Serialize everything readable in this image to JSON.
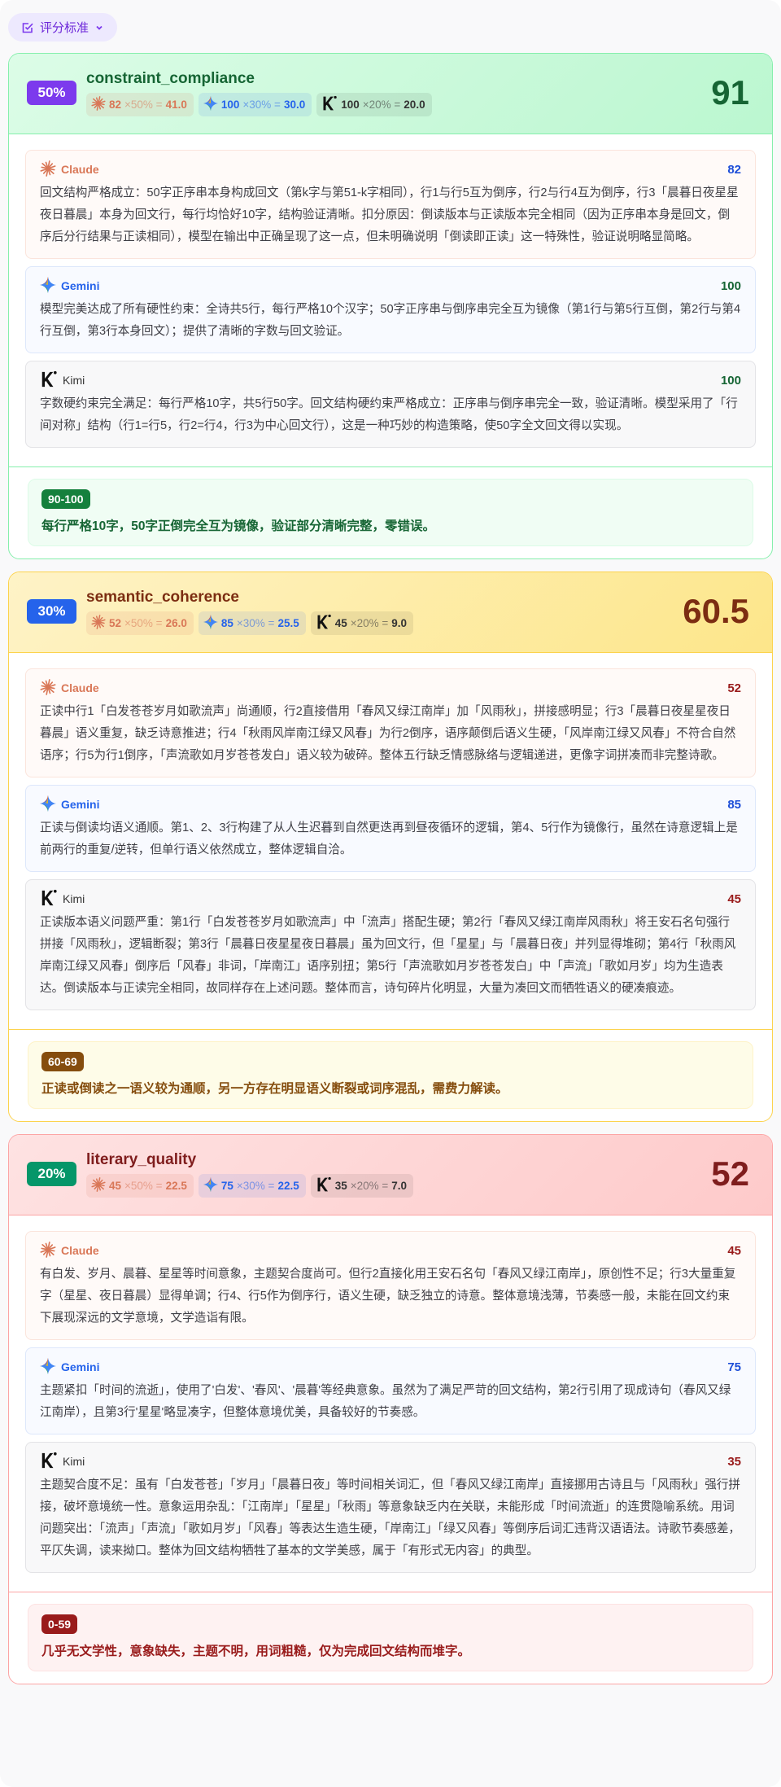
{
  "toggle": {
    "label": "评分标准",
    "icon": "checkbox-icon",
    "chevron": "chevron-down-icon"
  },
  "colors": {
    "claude": "#d97757",
    "gemini": "#2563eb",
    "kimi": "#222222",
    "score_high": "#166534",
    "score_mid": "#1d4ed8",
    "score_low": "#991b1b"
  },
  "sections": [
    {
      "weight": "50%",
      "criterion": "constraint_compliance",
      "total": "91",
      "theme": {
        "bg1": "#dcfce7",
        "bg2": "#bbf7d0",
        "border": "#86efac",
        "title": "#166534",
        "weight_bg": "#7c3aed",
        "rub_bg": "#f0fdf4",
        "rub_border": "#dcfce7",
        "rub_badge": "#15803d",
        "rub_text": "#166534"
      },
      "chips": [
        {
          "model": "claude",
          "score": "82",
          "mul": "×50% =",
          "result": "41.0"
        },
        {
          "model": "gemini",
          "score": "100",
          "mul": "×30% =",
          "result": "30.0"
        },
        {
          "model": "kimi",
          "score": "100",
          "mul": "×20% =",
          "result": "20.0"
        }
      ],
      "cards": [
        {
          "model": "claude",
          "name": "Claude",
          "score": "82",
          "level": "mid",
          "text": "回文结构严格成立：50字正序串本身构成回文（第k字与第51-k字相同），行1与行5互为倒序，行2与行4互为倒序，行3「晨暮日夜星星夜日暮晨」本身为回文行，每行均恰好10字，结构验证清晰。扣分原因：倒读版本与正读版本完全相同（因为正序串本身是回文，倒序后分行结果与正读相同），模型在输出中正确呈现了这一点，但未明确说明「倒读即正读」这一特殊性，验证说明略显简略。"
        },
        {
          "model": "gemini",
          "name": "Gemini",
          "score": "100",
          "level": "high",
          "text": "模型完美达成了所有硬性约束：全诗共5行，每行严格10个汉字；50字正序串与倒序串完全互为镜像（第1行与第5行互倒，第2行与第4行互倒，第3行本身回文）；提供了清晰的字数与回文验证。"
        },
        {
          "model": "kimi",
          "name": "Kimi",
          "score": "100",
          "level": "high",
          "text": "字数硬约束完全满足：每行严格10字，共5行50字。回文结构硬约束严格成立：正序串与倒序串完全一致，验证清晰。模型采用了「行间对称」结构（行1=行5，行2=行4，行3为中心回文行），这是一种巧妙的构造策略，使50字全文回文得以实现。"
        }
      ],
      "rubric": {
        "range": "90-100",
        "text": "每行严格10字，50字正倒完全互为镜像，验证部分清晰完整，零错误。"
      }
    },
    {
      "weight": "30%",
      "criterion": "semantic_coherence",
      "total": "60.5",
      "theme": {
        "bg1": "#fef3c7",
        "bg2": "#fde68a",
        "border": "#fcd34d",
        "title": "#7c2d12",
        "weight_bg": "#2563eb",
        "rub_bg": "#fefce8",
        "rub_border": "#fef3c7",
        "rub_badge": "#854d0e",
        "rub_text": "#854d0e"
      },
      "chips": [
        {
          "model": "claude",
          "score": "52",
          "mul": "×50% =",
          "result": "26.0"
        },
        {
          "model": "gemini",
          "score": "85",
          "mul": "×30% =",
          "result": "25.5"
        },
        {
          "model": "kimi",
          "score": "45",
          "mul": "×20% =",
          "result": "9.0"
        }
      ],
      "cards": [
        {
          "model": "claude",
          "name": "Claude",
          "score": "52",
          "level": "low",
          "text": "正读中行1「白发苍苍岁月如歌流声」尚通顺，行2直接借用「春风又绿江南岸」加「风雨秋」，拼接感明显；行3「晨暮日夜星星夜日暮晨」语义重复，缺乏诗意推进；行4「秋雨风岸南江绿又风春」为行2倒序，语序颠倒后语义生硬，「风岸南江绿又风春」不符合自然语序；行5为行1倒序，「声流歌如月岁苍苍发白」语义较为破碎。整体五行缺乏情感脉络与逻辑递进，更像字词拼凑而非完整诗歌。"
        },
        {
          "model": "gemini",
          "name": "Gemini",
          "score": "85",
          "level": "mid",
          "text": "正读与倒读均语义通顺。第1、2、3行构建了从人生迟暮到自然更迭再到昼夜循环的逻辑，第4、5行作为镜像行，虽然在诗意逻辑上是前两行的重复/逆转，但单行语义依然成立，整体逻辑自洽。"
        },
        {
          "model": "kimi",
          "name": "Kimi",
          "score": "45",
          "level": "low",
          "text": "正读版本语义问题严重：第1行「白发苍苍岁月如歌流声」中「流声」搭配生硬；第2行「春风又绿江南岸风雨秋」将王安石名句强行拼接「风雨秋」，逻辑断裂；第3行「晨暮日夜星星夜日暮晨」虽为回文行，但「星星」与「晨暮日夜」并列显得堆砌；第4行「秋雨风岸南江绿又风春」倒序后「风春」非词，「岸南江」语序别扭；第5行「声流歌如月岁苍苍发白」中「声流」「歌如月岁」均为生造表达。倒读版本与正读完全相同，故同样存在上述问题。整体而言，诗句碎片化明显，大量为凑回文而牺牲语义的硬凑痕迹。"
        }
      ],
      "rubric": {
        "range": "60-69",
        "text": "正读或倒读之一语义较为通顺，另一方存在明显语义断裂或词序混乱，需费力解读。"
      }
    },
    {
      "weight": "20%",
      "criterion": "literary_quality",
      "total": "52",
      "theme": {
        "bg1": "#fee2e2",
        "bg2": "#fecaca",
        "border": "#fca5a5",
        "title": "#7f1d1d",
        "weight_bg": "#059669",
        "rub_bg": "#fef2f2",
        "rub_border": "#fde2e2",
        "rub_badge": "#991b1b",
        "rub_text": "#991b1b"
      },
      "chips": [
        {
          "model": "claude",
          "score": "45",
          "mul": "×50% =",
          "result": "22.5"
        },
        {
          "model": "gemini",
          "score": "75",
          "mul": "×30% =",
          "result": "22.5"
        },
        {
          "model": "kimi",
          "score": "35",
          "mul": "×20% =",
          "result": "7.0"
        }
      ],
      "cards": [
        {
          "model": "claude",
          "name": "Claude",
          "score": "45",
          "level": "low",
          "text": "有白发、岁月、晨暮、星星等时间意象，主题契合度尚可。但行2直接化用王安石名句「春风又绿江南岸」，原创性不足；行3大量重复字（星星、夜日暮晨）显得单调；行4、行5作为倒序行，语义生硬，缺乏独立的诗意。整体意境浅薄，节奏感一般，未能在回文约束下展现深远的文学意境，文学造诣有限。"
        },
        {
          "model": "gemini",
          "name": "Gemini",
          "score": "75",
          "level": "mid",
          "text": "主题紧扣「时间的流逝」，使用了'白发'、'春风'、'晨暮'等经典意象。虽然为了满足严苛的回文结构，第2行引用了现成诗句（春风又绿江南岸），且第3行'星星'略显凑字，但整体意境优美，具备较好的节奏感。"
        },
        {
          "model": "kimi",
          "name": "Kimi",
          "score": "35",
          "level": "low",
          "text": "主题契合度不足：虽有「白发苍苍」「岁月」「晨暮日夜」等时间相关词汇，但「春风又绿江南岸」直接挪用古诗且与「风雨秋」强行拼接，破坏意境统一性。意象运用杂乱：「江南岸」「星星」「秋雨」等意象缺乏内在关联，未能形成「时间流逝」的连贯隐喻系统。用词问题突出：「流声」「声流」「歌如月岁」「风春」等表达生造生硬，「岸南江」「绿又风春」等倒序后词汇违背汉语语法。诗歌节奏感差，平仄失调，读来拗口。整体为回文结构牺牲了基本的文学美感，属于「有形式无内容」的典型。"
        }
      ],
      "rubric": {
        "range": "0-59",
        "text": "几乎无文学性，意象缺失，主题不明，用词粗糙，仅为完成回文结构而堆字。"
      }
    }
  ]
}
